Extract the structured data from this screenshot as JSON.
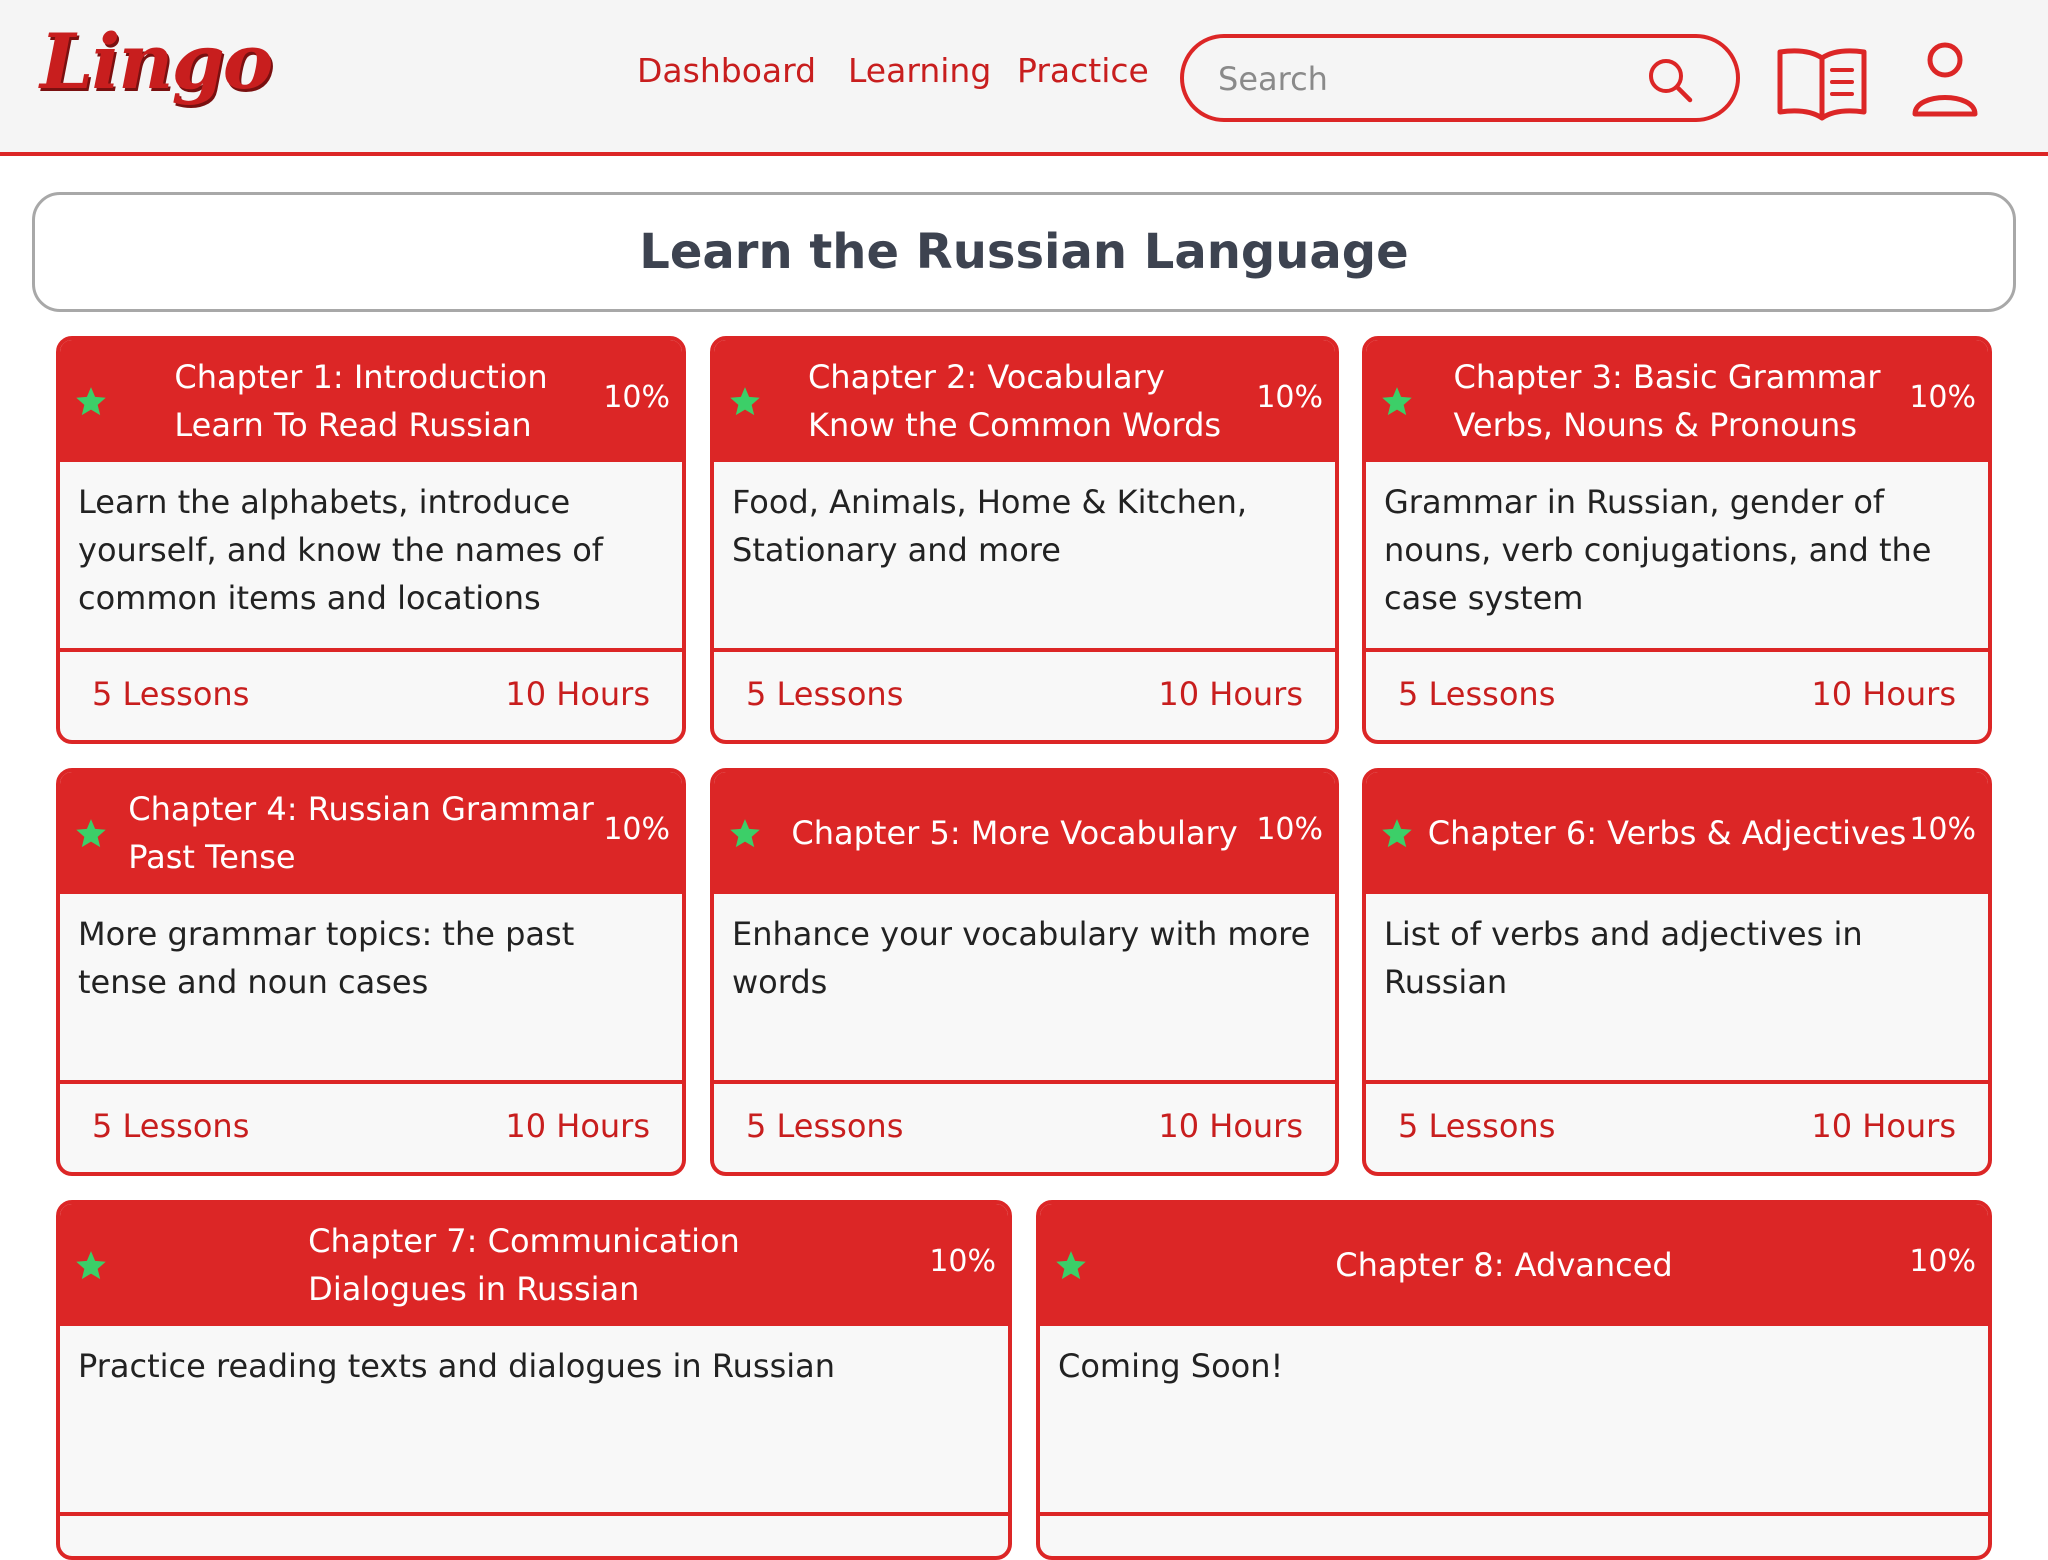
{
  "header": {
    "logo": "Lingo",
    "nav": {
      "dashboard": "Dashboard",
      "learning": "Learning",
      "practice": "Practice"
    },
    "search": {
      "placeholder": "Search",
      "value": ""
    },
    "icons": {
      "search": "search-icon",
      "book": "book-icon",
      "user": "user-icon"
    }
  },
  "page": {
    "title": "Learn the Russian Language"
  },
  "colors": {
    "accent": "#dc2626",
    "star": "#3ccf68",
    "title": "#3d4350"
  },
  "chapters": [
    {
      "title_line1": "Chapter 1: Introduction",
      "title_line2": "Learn To Read Russian",
      "progress": "10%",
      "description": "Learn the alphabets, introduce yourself, and know the names of common items and locations",
      "lessons": "5 Lessons",
      "hours": "10 Hours"
    },
    {
      "title_line1": "Chapter 2: Vocabulary",
      "title_line2": "Know the Common Words",
      "progress": "10%",
      "description": "Food, Animals, Home & Kitchen, Stationary and more",
      "lessons": "5 Lessons",
      "hours": "10 Hours"
    },
    {
      "title_line1": "Chapter 3: Basic Grammar",
      "title_line2": "Verbs, Nouns & Pronouns",
      "progress": "10%",
      "description": "Grammar in Russian, gender of nouns, verb conjugations, and the case system",
      "lessons": "5 Lessons",
      "hours": "10 Hours"
    },
    {
      "title_line1": "Chapter 4: Russian Grammar",
      "title_line2": "Past Tense",
      "progress": "10%",
      "description": "More grammar topics: the past tense and noun cases",
      "lessons": "5 Lessons",
      "hours": "10 Hours"
    },
    {
      "title_line1": "Chapter 5: More Vocabulary",
      "title_line2": "",
      "progress": "10%",
      "description": "Enhance your vocabulary with more words",
      "lessons": "5 Lessons",
      "hours": "10 Hours"
    },
    {
      "title_line1": "Chapter 6: Verbs & Adjectives",
      "title_line2": "",
      "progress": "10%",
      "description": "List of verbs and adjectives in Russian",
      "lessons": "5 Lessons",
      "hours": "10 Hours"
    },
    {
      "title_line1": "Chapter 7: Communication",
      "title_line2": "Dialogues in Russian",
      "progress": "10%",
      "description": "Practice reading texts and dialogues in Russian",
      "lessons": "",
      "hours": ""
    },
    {
      "title_line1": "Chapter 8: Advanced",
      "title_line2": "",
      "progress": "10%",
      "description": "Coming Soon!",
      "lessons": "",
      "hours": ""
    }
  ]
}
